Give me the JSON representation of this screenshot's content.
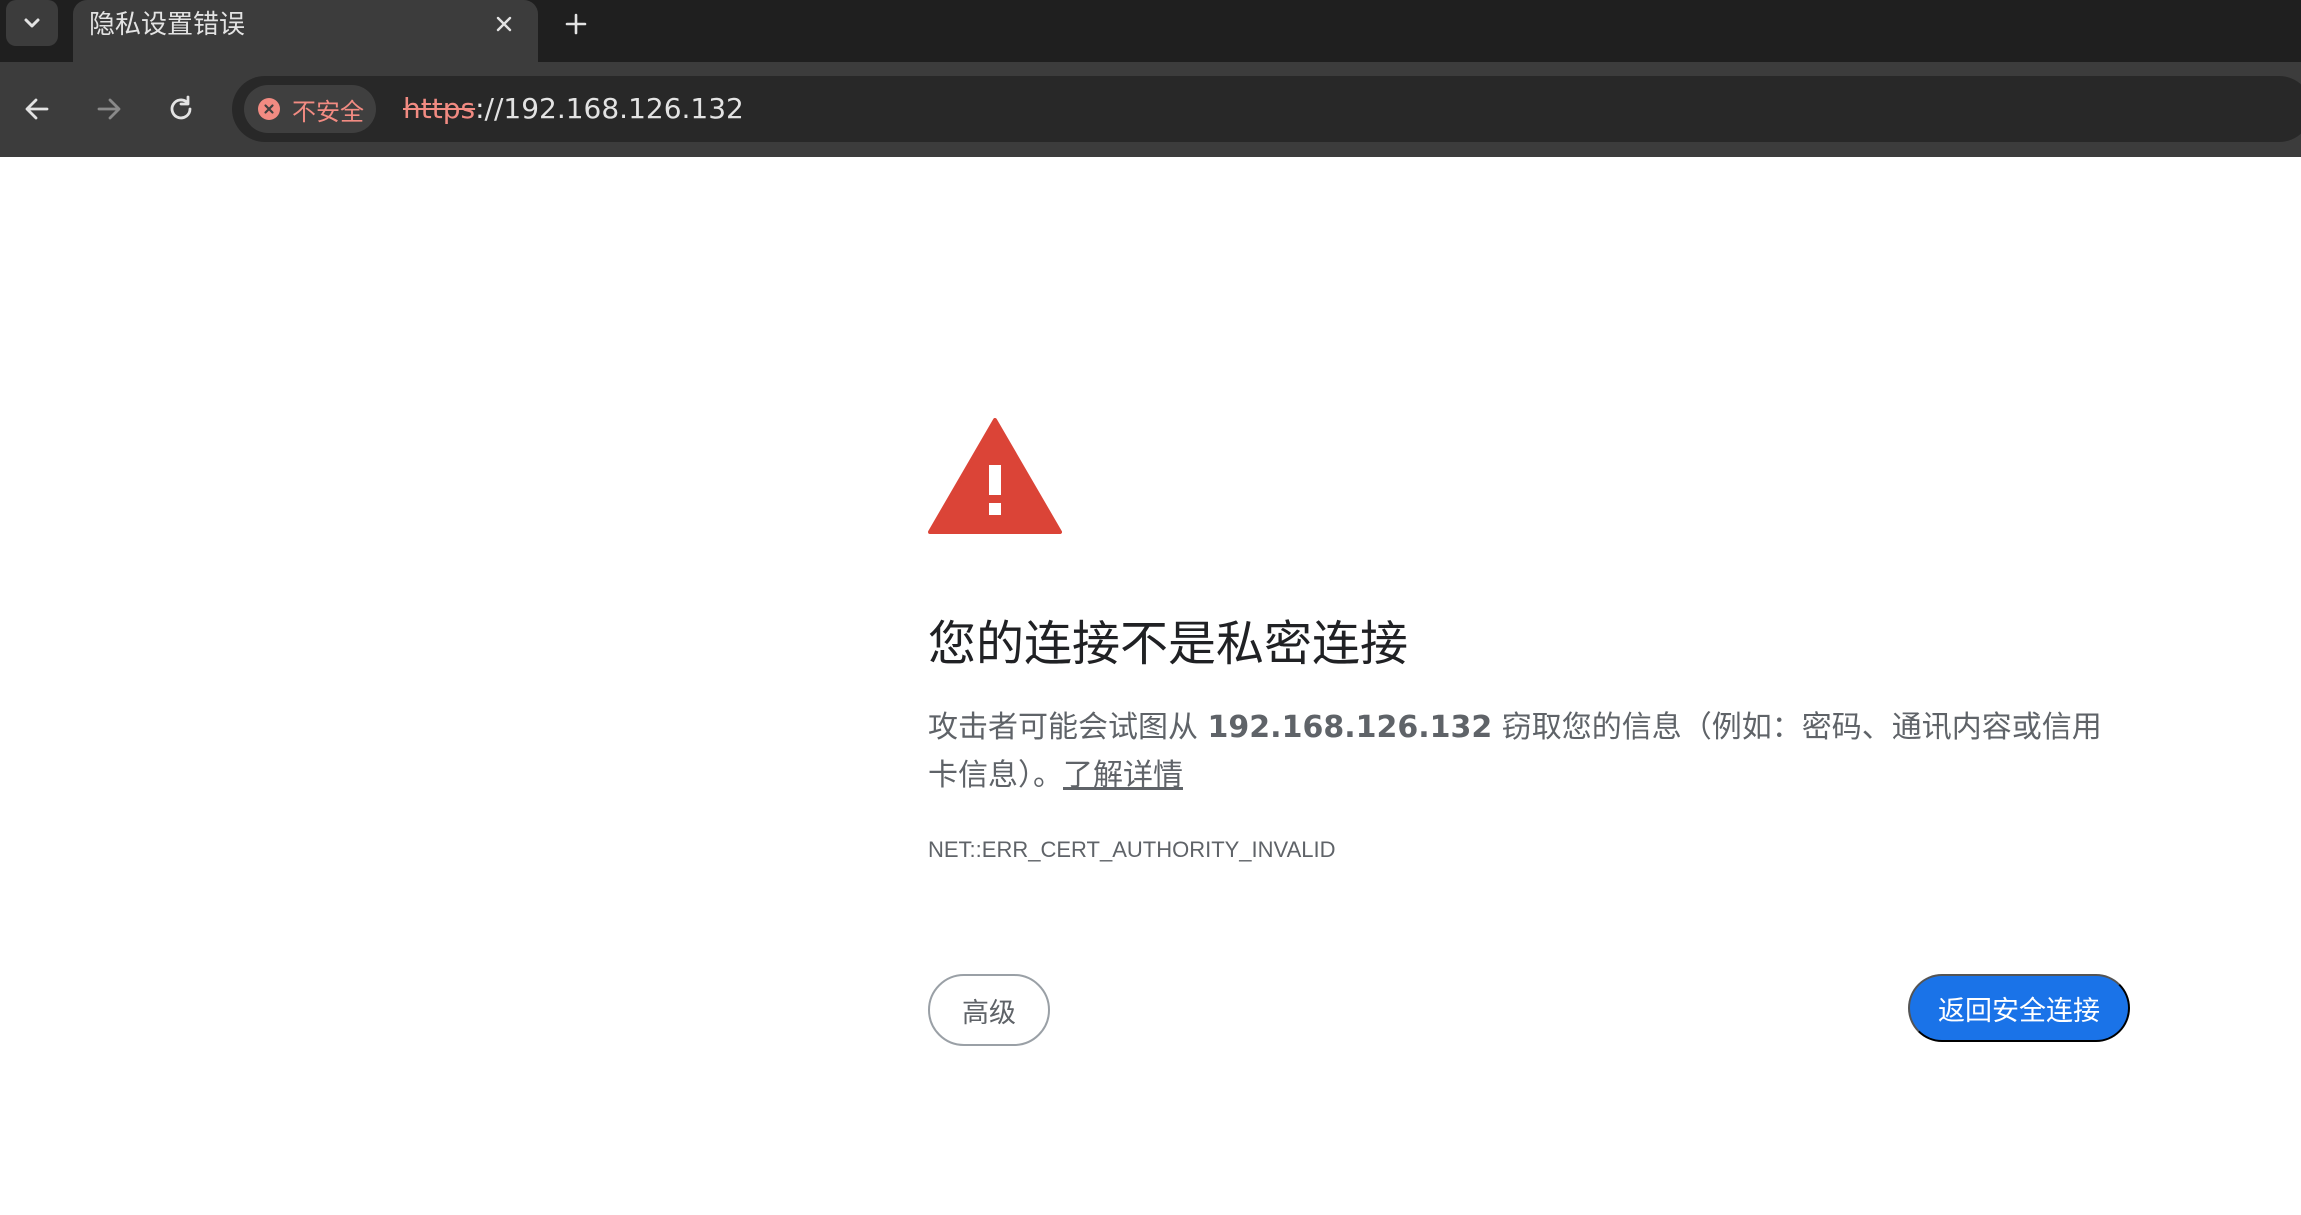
{
  "browser": {
    "tab": {
      "title": "隐私设置错误",
      "search_icon": "chevron-down-icon",
      "close_icon": "close-icon",
      "new_tab_icon": "plus-icon"
    },
    "toolbar": {
      "back_icon": "back-arrow-icon",
      "forward_icon": "forward-arrow-icon",
      "reload_icon": "reload-icon",
      "security_chip_label": "不安全",
      "url_scheme": "https",
      "url_rest": "://192.168.126.132"
    }
  },
  "page": {
    "heading": "您的连接不是私密连接",
    "explanation_prefix": "攻击者可能会试图从 ",
    "host": "192.168.126.132",
    "explanation_suffix": " 窃取您的信息（例如：密码、通讯内容或信用卡信息）。",
    "learn_more": "了解详情",
    "error_code": "NET::ERR_CERT_AUTHORITY_INVALID",
    "advanced_button": "高级",
    "back_button": "返回安全连接"
  },
  "colors": {
    "warning_red": "#db4437",
    "primary_blue": "#1a73e8",
    "insecure_red": "#f28b82"
  }
}
